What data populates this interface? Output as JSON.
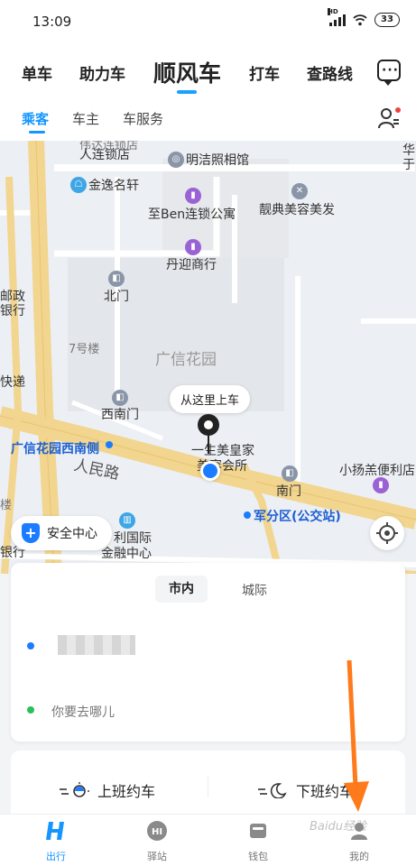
{
  "status_bar": {
    "time": "13:09",
    "battery": "33",
    "net_label": "HD"
  },
  "top_nav": {
    "tabs": [
      {
        "label": "单车"
      },
      {
        "label": "助力车"
      },
      {
        "label": "顺风车"
      },
      {
        "label": "打车"
      },
      {
        "label": "查路线"
      }
    ],
    "active_tab": "顺风车",
    "message_icon": "chat-icon"
  },
  "sub_nav": {
    "tabs": [
      {
        "label": "乘客"
      },
      {
        "label": "车主"
      },
      {
        "label": "车服务"
      }
    ],
    "active_tab": "乘客",
    "profile_icon": "person-settings-icon"
  },
  "map": {
    "pois": {
      "p1": "人连锁店",
      "p2": "明洁照相馆",
      "p3": "金逸名轩",
      "p4": "至Ben连锁公寓",
      "p5": "靓典美容美发",
      "p6": "丹迎商行",
      "p7": "北门",
      "p8": "7号楼",
      "p9": "广信花园",
      "p10": "西南门",
      "p11": "广信花园西南侧",
      "p12": "人民路",
      "p13": "一生美皇家",
      "p14": "美容会所",
      "p15": "南门",
      "p16": "小扬羔便利店",
      "p17": "军分区(公交站)",
      "p18": "利国际",
      "p19": "金融中心",
      "p20": "邮政",
      "p21": "银行",
      "p22": "快递",
      "p23": "楼",
      "p24": "银行",
      "p25": "华",
      "p26": "于",
      "p27": "伟达连锁店"
    },
    "pickup_bubble": "从这里上车",
    "safety_center": "安全中心",
    "locate_icon": "locate-icon"
  },
  "route_card": {
    "tabs": {
      "city": "市内",
      "intercity": "城际"
    },
    "active_tab": "市内",
    "destination_placeholder": "你要去哪儿"
  },
  "commute": {
    "to_work": "上班约车",
    "off_work": "下班约车"
  },
  "bottom_bar": {
    "items": [
      {
        "label": "出行",
        "icon": "h-logo-icon"
      },
      {
        "label": "驿站",
        "icon": "hi-icon"
      },
      {
        "label": "钱包",
        "icon": "wallet-icon"
      },
      {
        "label": "我的",
        "icon": "profile-icon"
      }
    ],
    "active": "出行"
  },
  "watermark": "Baidu经验",
  "colors": {
    "accent": "#1596ff",
    "road": "#f2d58e",
    "annotation_arrow": "#ff7a1a"
  }
}
